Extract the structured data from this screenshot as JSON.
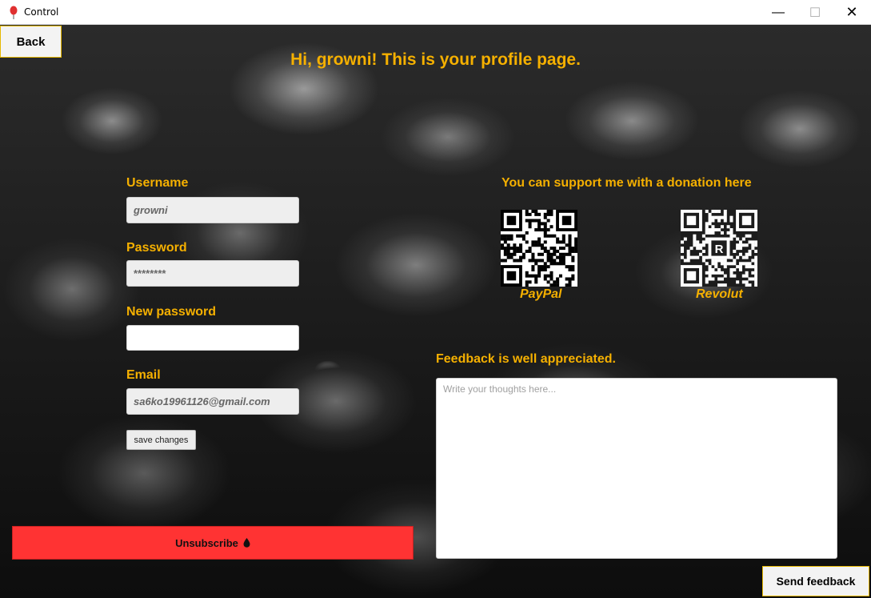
{
  "window": {
    "title": "Control",
    "icon": "balloon-icon",
    "controls": {
      "minimize": "—",
      "maximize": "☐",
      "close": "✕"
    }
  },
  "nav": {
    "back_label": "Back"
  },
  "header": {
    "greeting": "Hi, growni! This is your profile page."
  },
  "profile": {
    "username_label": "Username",
    "username_value": "growni",
    "password_label": "Password",
    "password_value": "********",
    "new_password_label": "New password",
    "new_password_value": "",
    "email_label": "Email",
    "email_value": "sa6ko19961126@gmail.com",
    "save_label": "save changes"
  },
  "unsubscribe": {
    "label": "Unsubscribe",
    "icon": "drop-icon",
    "color": "#ff3333"
  },
  "donation": {
    "heading": "You can support me with a donation here",
    "paypal_label": "PayPal",
    "revolut_label": "Revolut"
  },
  "feedback": {
    "heading": "Feedback is well appreciated.",
    "placeholder": "Write your thoughts here...",
    "value": "",
    "send_label": "Send feedback"
  },
  "colors": {
    "accent": "#f5b000",
    "danger": "#ff3333",
    "button_border": "#e6b800"
  }
}
